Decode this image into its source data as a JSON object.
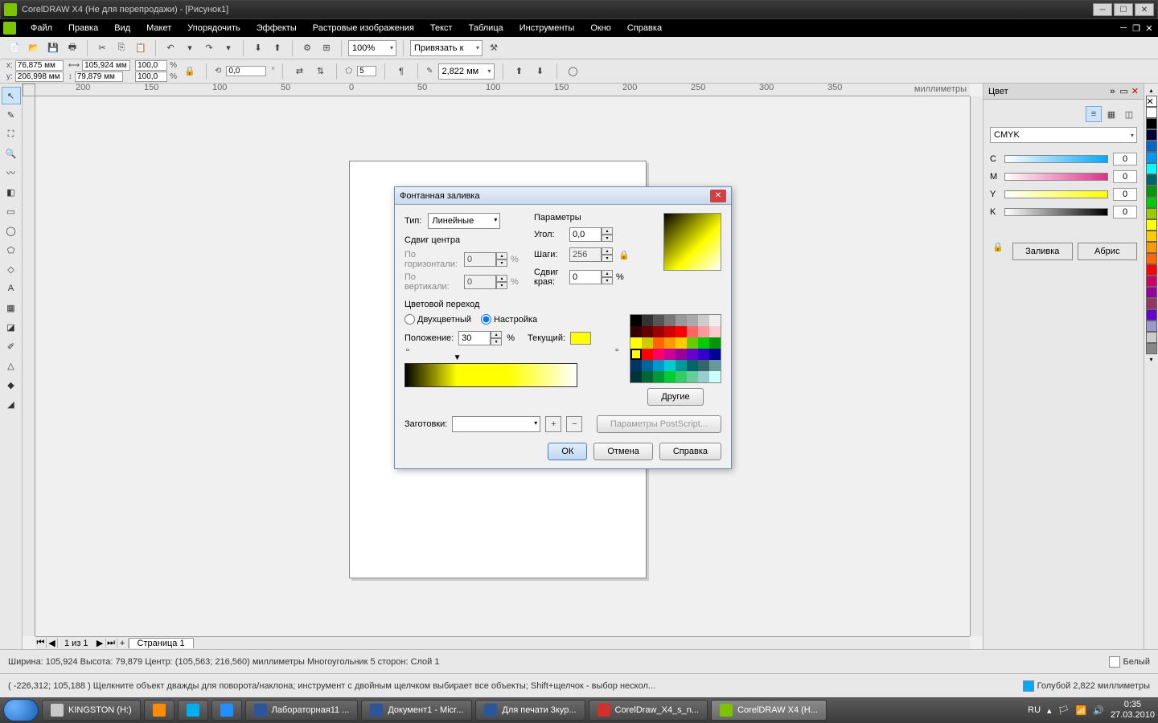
{
  "title": "CorelDRAW X4 (Не для перепродажи) - [Рисунок1]",
  "menu": [
    "Файл",
    "Правка",
    "Вид",
    "Макет",
    "Упорядочить",
    "Эффекты",
    "Растровые изображения",
    "Текст",
    "Таблица",
    "Инструменты",
    "Окно",
    "Справка"
  ],
  "toolbar": {
    "zoom": "100%",
    "bindto": "Привязать к"
  },
  "propbar": {
    "x": "76,875 мм",
    "y": "206,998 мм",
    "w": "105,924 мм",
    "h": "79,879 мм",
    "sx": "100,0",
    "sy": "100,0",
    "angle": "0,0",
    "sides": "5",
    "outline": "2,822 мм"
  },
  "ruler_h": [
    "200",
    "150",
    "100",
    "50",
    "0",
    "50",
    "100",
    "150",
    "200",
    "250",
    "300",
    "350"
  ],
  "ruler_unit": "миллиметры",
  "pagenav": {
    "pages": "1 из 1",
    "tab": "Страница 1"
  },
  "status1": "Ширина: 105,924  Высота: 79,879  Центр: (105,563; 216,560)  миллиметры       Многоугольник  5 сторон: Слой 1",
  "status2": "( -226,312; 105,188 )     Щелкните объект дважды для поворота/наклона; инструмент с двойным щелчком выбирает все объекты; Shift+щелчок - выбор нескол...",
  "status_right": {
    "fill": "Белый",
    "outline": "Голубой  2,822 миллиметры"
  },
  "docker": {
    "title": "Цвет",
    "model": "CMYK",
    "channels": [
      {
        "l": "C",
        "v": "0",
        "c1": "#fff",
        "c2": "#0af"
      },
      {
        "l": "M",
        "v": "0",
        "c1": "#fff",
        "c2": "#e0308a"
      },
      {
        "l": "Y",
        "v": "0",
        "c1": "#fff",
        "c2": "#ff0"
      },
      {
        "l": "K",
        "v": "0",
        "c1": "#fff",
        "c2": "#000"
      }
    ],
    "btn_fill": "Заливка",
    "btn_outline": "Абрис"
  },
  "palette_colors": [
    "#fff",
    "#000",
    "#003",
    "#06c",
    "#09f",
    "#0ff",
    "#066",
    "#090",
    "#0c0",
    "#9c0",
    "#ff0",
    "#fc0",
    "#f90",
    "#f60",
    "#f00",
    "#c06",
    "#909",
    "#936",
    "#60c",
    "#99c",
    "#ccc",
    "#888"
  ],
  "dialog": {
    "title": "Фонтанная заливка",
    "type_label": "Тип:",
    "type_value": "Линейные",
    "centershift": "Сдвиг центра",
    "horiz": "По горизонтали:",
    "vert": "По вертикали:",
    "horiz_v": "0",
    "vert_v": "0",
    "params": "Параметры",
    "angle": "Угол:",
    "angle_v": "0,0",
    "steps": "Шаги:",
    "steps_v": "256",
    "edgepad": "Сдвиг края:",
    "edgepad_v": "0",
    "colortrans": "Цветовой переход",
    "two": "Двухцветный",
    "custom": "Настройка",
    "position": "Положение:",
    "position_v": "30",
    "current": "Текущий:",
    "swatches_btn": "Другие",
    "presets": "Заготовки:",
    "ps": "Параметры PostScript...",
    "ok": "ОК",
    "cancel": "Отмена",
    "help": "Справка"
  },
  "taskbar": {
    "items": [
      {
        "label": "KINGSTON (H:)",
        "ico": "#c8c8c8"
      },
      {
        "label": "",
        "ico": "#ff8c00"
      },
      {
        "label": "",
        "ico": "#00aff0"
      },
      {
        "label": "",
        "ico": "#1e90ff"
      },
      {
        "label": "Лабораторная11 ...",
        "ico": "#2b579a"
      },
      {
        "label": "Документ1 - Micr...",
        "ico": "#2b579a"
      },
      {
        "label": "Для печати 3кур...",
        "ico": "#2b579a"
      },
      {
        "label": "CorelDraw_X4_s_n...",
        "ico": "#d32f2f"
      },
      {
        "label": "CorelDRAW X4 (Н...",
        "ico": "#7cc400",
        "active": true
      }
    ],
    "lang": "RU",
    "time": "0:35",
    "date": "27.03.2010"
  }
}
